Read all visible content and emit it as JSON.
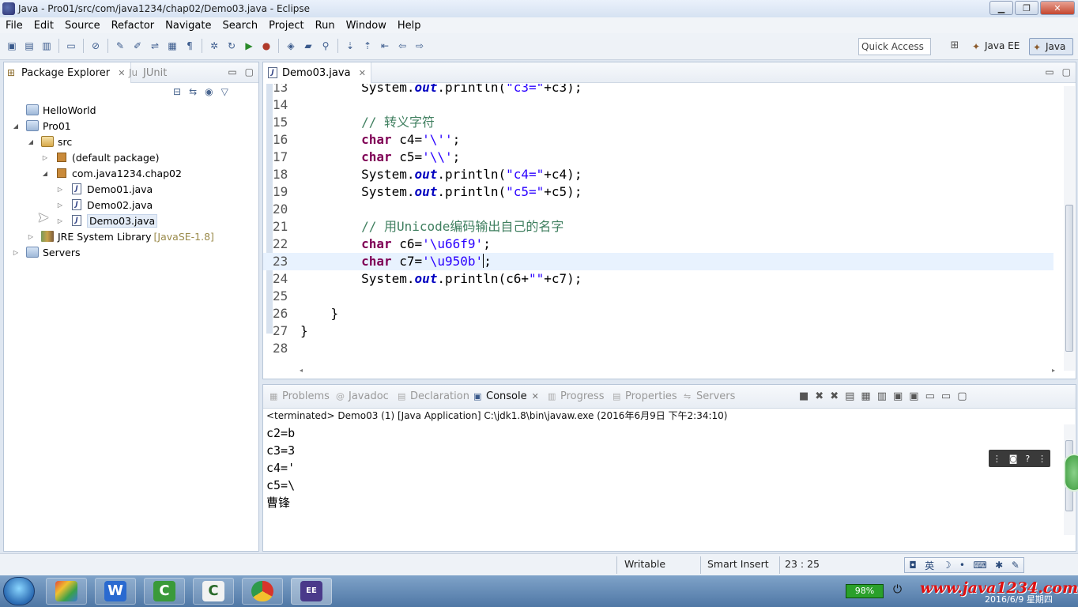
{
  "window": {
    "title": "Java - Pro01/src/com/java1234/chap02/Demo03.java - Eclipse",
    "minimize": "▁",
    "maximize": "❐",
    "close": "✕"
  },
  "menu": [
    "File",
    "Edit",
    "Source",
    "Refactor",
    "Navigate",
    "Search",
    "Project",
    "Run",
    "Window",
    "Help"
  ],
  "toolbar": {
    "quick_access": "Quick Access",
    "perspective_javaee": "Java EE",
    "perspective_java": "Java"
  },
  "package_explorer": {
    "tab_label": "Package Explorer",
    "junit_tab_label": "JUnit",
    "tree": [
      {
        "label": "HelloWorld",
        "icon": "project-folder-icon",
        "twisty": ""
      },
      {
        "label": "Pro01",
        "icon": "project-folder-icon",
        "twisty": "◢"
      },
      {
        "label": "src",
        "icon": "source-folder-icon",
        "twisty": "◢"
      },
      {
        "label": "(default package)",
        "icon": "package-icon",
        "twisty": "▷"
      },
      {
        "label": "com.java1234.chap02",
        "icon": "package-icon",
        "twisty": "◢"
      },
      {
        "label": "Demo01.java",
        "icon": "java-file-icon",
        "twisty": "▷"
      },
      {
        "label": "Demo02.java",
        "icon": "java-file-icon",
        "twisty": "▷"
      },
      {
        "label": "Demo03.java",
        "icon": "java-file-icon",
        "twisty": "▷"
      },
      {
        "label": "JRE System Library",
        "decoration": "[JavaSE-1.8]",
        "icon": "library-icon",
        "twisty": "▷"
      },
      {
        "label": "Servers",
        "icon": "project-folder-icon",
        "twisty": "▷"
      }
    ]
  },
  "editor": {
    "tab_label": "Demo03.java",
    "current_line": "23",
    "lines": [
      {
        "n": "13",
        "code": [
          [
            "",
            "        System."
          ],
          [
            "fld",
            "out"
          ],
          [
            "",
            ".println("
          ],
          [
            "str",
            "\"c3=\""
          ],
          [
            "",
            "+c3);"
          ]
        ]
      },
      {
        "n": "14",
        "code": []
      },
      {
        "n": "15",
        "code": [
          [
            "cmt",
            "        // 转义字符"
          ]
        ]
      },
      {
        "n": "16",
        "code": [
          [
            "kw",
            "        char"
          ],
          [
            "",
            " c4="
          ],
          [
            "str",
            "'\\''"
          ],
          [
            "",
            ";"
          ]
        ]
      },
      {
        "n": "17",
        "code": [
          [
            "kw",
            "        char"
          ],
          [
            "",
            " c5="
          ],
          [
            "str",
            "'\\\\'"
          ],
          [
            "",
            ";"
          ]
        ]
      },
      {
        "n": "18",
        "code": [
          [
            "",
            "        System."
          ],
          [
            "fld",
            "out"
          ],
          [
            "",
            ".println("
          ],
          [
            "str",
            "\"c4=\""
          ],
          [
            "",
            "+c4);"
          ]
        ]
      },
      {
        "n": "19",
        "code": [
          [
            "",
            "        System."
          ],
          [
            "fld",
            "out"
          ],
          [
            "",
            ".println("
          ],
          [
            "str",
            "\"c5=\""
          ],
          [
            "",
            "+c5);"
          ]
        ]
      },
      {
        "n": "20",
        "code": []
      },
      {
        "n": "21",
        "code": [
          [
            "cmt",
            "        // 用Unicode编码输出自己的名字"
          ]
        ]
      },
      {
        "n": "22",
        "code": [
          [
            "kw",
            "        char"
          ],
          [
            "",
            " c6="
          ],
          [
            "str",
            "'\\u66f9'"
          ],
          [
            "",
            ";"
          ]
        ]
      },
      {
        "n": "23",
        "code": [
          [
            "kw",
            "        char"
          ],
          [
            "",
            " c7="
          ],
          [
            "str",
            "'\\u950b'"
          ],
          [
            "caret",
            ""
          ],
          [
            "",
            ";"
          ]
        ]
      },
      {
        "n": "24",
        "code": [
          [
            "",
            "        System."
          ],
          [
            "fld",
            "out"
          ],
          [
            "",
            ".println(c6+"
          ],
          [
            "str",
            "\"\""
          ],
          [
            "",
            "+c7);"
          ]
        ]
      },
      {
        "n": "25",
        "code": []
      },
      {
        "n": "26",
        "code": [
          [
            "",
            "    }"
          ]
        ]
      },
      {
        "n": "27",
        "code": [
          [
            "",
            "}"
          ]
        ]
      },
      {
        "n": "28",
        "code": []
      }
    ]
  },
  "console": {
    "tabs": [
      "Problems",
      "Javadoc",
      "Declaration",
      "Console",
      "Progress",
      "Properties",
      "Servers"
    ],
    "active_tab": "Console",
    "status": "<terminated> Demo03 (1) [Java Application] C:\\jdk1.8\\bin\\javaw.exe (2016年6月9日 下午2:34:10)",
    "output": [
      "c2=b",
      "c3=3",
      "c4='",
      "c5=\\",
      "曹锋"
    ]
  },
  "statusbar": {
    "writable": "Writable",
    "insert_mode": "Smart Insert",
    "position": "23 : 25",
    "ime": "英"
  },
  "taskbar": {
    "battery": "98%",
    "watermark": "www.java1234.com",
    "date": "2016/6/9 星期四"
  }
}
